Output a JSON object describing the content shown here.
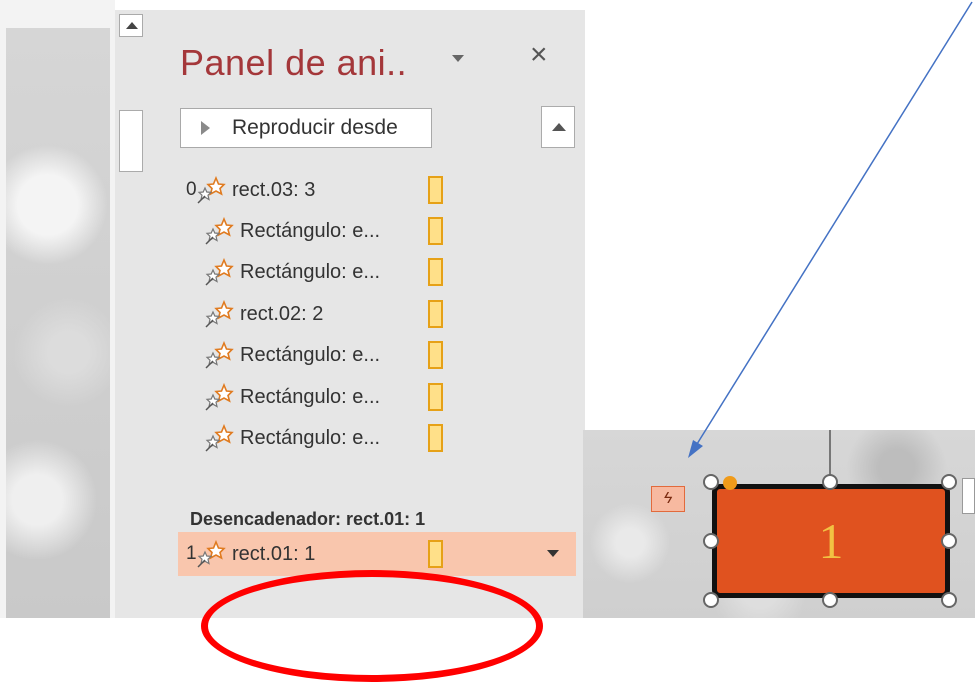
{
  "pane": {
    "title": "Panel de ani..",
    "play_button_label": "Reproducir desde"
  },
  "animations": [
    {
      "number": "0",
      "label": "rect.03: 3"
    },
    {
      "number": "",
      "label": "Rectángulo: e..."
    },
    {
      "number": "",
      "label": "Rectángulo: e..."
    },
    {
      "number": "",
      "label": "rect.02: 2"
    },
    {
      "number": "",
      "label": "Rectángulo: e..."
    },
    {
      "number": "",
      "label": "Rectángulo: e..."
    },
    {
      "number": "",
      "label": "Rectángulo: e..."
    }
  ],
  "trigger": {
    "label": "Desencadenador: rect.01: 1",
    "item": {
      "number": "1",
      "label": "rect.01: 1"
    }
  },
  "slide": {
    "shape_text": "1"
  },
  "colors": {
    "pane_title": "#a4373a",
    "selected_row": "#f9c6ad",
    "shape_fill": "#e0521f",
    "shape_text": "#f2c243",
    "annotation_arrow": "#4472c4",
    "annotation_ellipse": "#ff0000"
  },
  "icons": {
    "animation_effect": "star-animation-icon",
    "trigger": "lightning-icon",
    "close": "close-icon"
  }
}
